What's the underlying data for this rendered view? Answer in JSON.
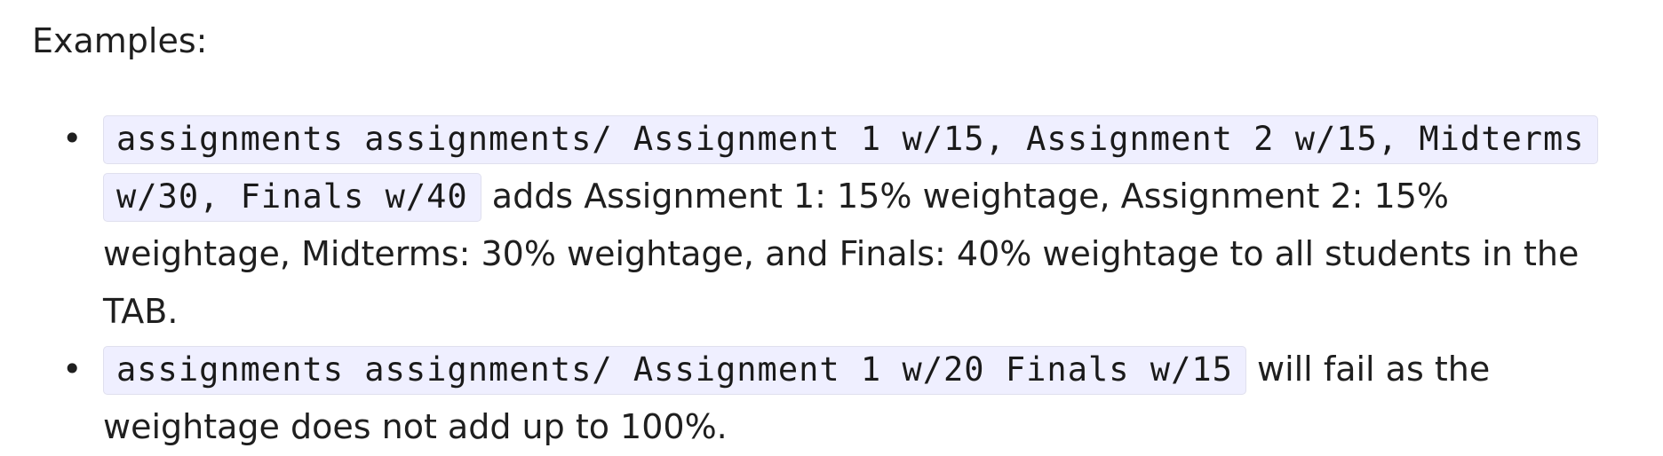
{
  "heading": "Examples:",
  "examples": [
    {
      "command": "assignments assignments/ Assignment 1 w/15, Assignment 2 w/15, Midterms w/30, Finals w/40",
      "description": " adds Assignment 1: 15% weightage, Assignment 2: 15% weightage, Midterms: 30% weightage, and Finals: 40% weightage to all students in the TAB."
    },
    {
      "command": "assignments assignments/ Assignment 1 w/20 Finals w/15",
      "description": " will fail as the weightage does not add up to 100%."
    }
  ],
  "bullet_glyph": "•",
  "colors": {
    "code_background": "#efefff",
    "code_border": "#e0e0ee",
    "text": "#1f1f1f"
  }
}
